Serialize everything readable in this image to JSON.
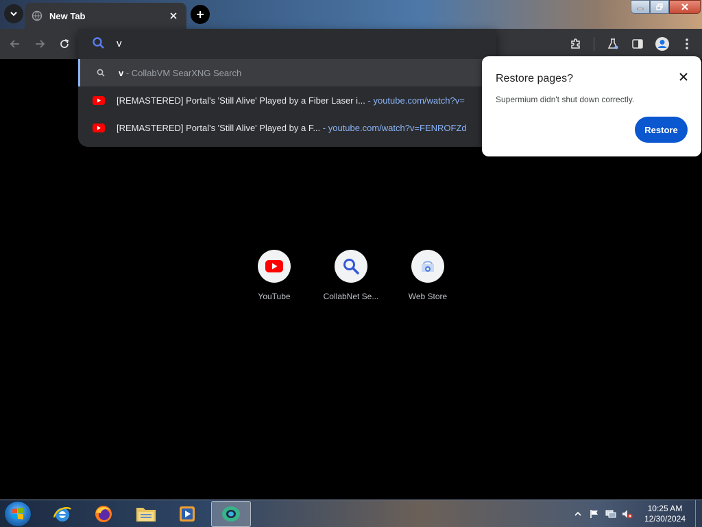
{
  "browser": {
    "tab": {
      "title": "New Tab"
    },
    "omnibox": {
      "value": "v"
    },
    "suggestions": [
      {
        "query": "v",
        "sep": " - ",
        "provider": "CollabVM SearXNG Search"
      },
      {
        "title": "[REMASTERED] Portal's 'Still Alive' Played by a Fiber Laser i...",
        "sep": " - ",
        "url": "youtube.com/watch?v="
      },
      {
        "title": "[REMASTERED] Portal's 'Still Alive' Played by a F...",
        "sep": " - ",
        "url": "youtube.com/watch?v=FENROFZd"
      }
    ]
  },
  "restore_popup": {
    "title": "Restore pages?",
    "body": "Supermium didn't shut down correctly.",
    "button": "Restore"
  },
  "shortcuts": [
    {
      "label": "YouTube",
      "icon": "youtube-icon"
    },
    {
      "label": "CollabNet Se...",
      "icon": "search-icon"
    },
    {
      "label": "Web Store",
      "icon": "webstore-icon"
    }
  ],
  "taskbar": {
    "clock_time": "10:25 AM",
    "clock_date": "12/30/2024"
  },
  "colors": {
    "accent": "#0b57d0",
    "link": "#8ab4f8",
    "youtube_red": "#ff0000",
    "toolbar": "#35363a"
  }
}
